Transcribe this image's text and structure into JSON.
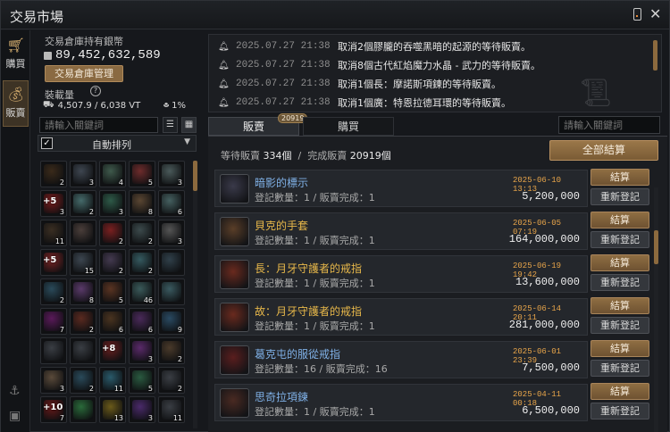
{
  "window": {
    "title": "交易市場"
  },
  "nav": {
    "buy": "購買",
    "sell": "販賣"
  },
  "storage": {
    "silver_label": "交易倉庫持有銀幣",
    "silver_value": "89,452,632,589",
    "manage_button": "交易倉庫管理",
    "weight_label": "裝載量",
    "weight_value": "4,507.9 / 6,038 VT",
    "percent": "1%"
  },
  "filter": {
    "search_placeholder": "請輸入關鍵詞",
    "auto_sort_label": "自動排列",
    "auto_sort_checked": "✓"
  },
  "inventory": [
    {
      "color": "#3a2a1a",
      "count": "2"
    },
    {
      "color": "#3e4650",
      "count": "3"
    },
    {
      "color": "#3f5a4c",
      "count": "4"
    },
    {
      "color": "#6e2c2c",
      "count": "5"
    },
    {
      "color": "#4a5a5a",
      "count": "3"
    },
    {
      "color": "#7a1c1c",
      "count": "3",
      "enh": "+5"
    },
    {
      "color": "#456a6a",
      "count": "2"
    },
    {
      "color": "#2e5a48",
      "count": "3"
    },
    {
      "color": "#5a4632",
      "count": "8"
    },
    {
      "color": "#456060",
      "count": "6"
    },
    {
      "color": "#3a2e22",
      "count": "11"
    },
    {
      "color": "#4a3e3a",
      "count": ""
    },
    {
      "color": "#7a2020",
      "count": "2"
    },
    {
      "color": "#3c4a4c",
      "count": "2"
    },
    {
      "color": "#555555",
      "count": "3"
    },
    {
      "color": "#7a2424",
      "count": "",
      "enh": "+5"
    },
    {
      "color": "#3c4650",
      "count": "15"
    },
    {
      "color": "#443a50",
      "count": "2"
    },
    {
      "color": "#355a60",
      "count": "2"
    },
    {
      "color": "#30404a",
      "count": ""
    },
    {
      "color": "#2a4a5a",
      "count": "2"
    },
    {
      "color": "#5a3a6a",
      "count": "8"
    },
    {
      "color": "#5a3422",
      "count": "5"
    },
    {
      "color": "#3a5a5a",
      "count": "46"
    },
    {
      "color": "#3a5a60",
      "count": ""
    },
    {
      "color": "#5a1a5a",
      "count": "7"
    },
    {
      "color": "#5a2a20",
      "count": "2"
    },
    {
      "color": "#4a3420",
      "count": "6"
    },
    {
      "color": "#4a2a5a",
      "count": "6"
    },
    {
      "color": "#2a4a62",
      "count": "9"
    },
    {
      "color": "#3a3e44",
      "count": ""
    },
    {
      "color": "#3a3e44",
      "count": ""
    },
    {
      "color": "#6a2020",
      "count": "",
      "enh": "+8"
    },
    {
      "color": "#5a2a6a",
      "count": "3"
    },
    {
      "color": "#4a3a2a",
      "count": "2"
    },
    {
      "color": "#5a4a3a",
      "count": "3"
    },
    {
      "color": "#2a4a5a",
      "count": "2"
    },
    {
      "color": "#2a5a6a",
      "count": "11"
    },
    {
      "color": "#2a5a40",
      "count": "5"
    },
    {
      "color": "#3a3e44",
      "count": "2"
    },
    {
      "color": "#6a1a1a",
      "count": "7",
      "enh": "+10"
    },
    {
      "color": "#2a6a3a",
      "count": ""
    },
    {
      "color": "#6a5a1a",
      "count": "13"
    },
    {
      "color": "#4a2a6a",
      "count": "3"
    },
    {
      "color": "#3a3e44",
      "count": "11"
    }
  ],
  "notices": [
    {
      "date": "2025.07.27 21:38",
      "text": "取消2個膠朧的吞噬黑暗的起源的等待販賣。"
    },
    {
      "date": "2025.07.27 21:38",
      "text": "取消8個古代紅焰魔力水晶 - 武力的等待販賣。"
    },
    {
      "date": "2025.07.27 21:38",
      "text": "取消1個長：摩諾斯項鍊的等待販賣。"
    },
    {
      "date": "2025.07.27 21:38",
      "text": "取消1個廣：特恩拉德耳環的等待販賣。"
    }
  ],
  "tabs": {
    "sell": "販賣",
    "sell_badge": "20919",
    "buy": "購買",
    "search_placeholder": "請輸入關鍵詞"
  },
  "summary": {
    "pending_label": "等待販賣",
    "pending_value": "334個",
    "sep": "/",
    "done_label": "完成販賣",
    "done_value": "20919個",
    "settle_all": "全部結算"
  },
  "buttons": {
    "settle": "結算",
    "relist": "重新登記"
  },
  "items": [
    {
      "name": "暗影的標示",
      "name_color": "#7fb0e6",
      "sub": "登記數量：1 / 販賣完成：1",
      "date": "2025-06-10 13:13",
      "price": "5,200,000",
      "icon_color": "#3a3a4a"
    },
    {
      "name": "貝克的手套",
      "name_color": "#e8b84a",
      "sub": "登記數量：1 / 販賣完成：1",
      "date": "2025-06-05 07:19",
      "price": "164,000,000",
      "icon_color": "#5a3e28"
    },
    {
      "name": "長：月牙守護者的戒指",
      "name_color": "#e8b84a",
      "sub": "登記數量：1 / 販賣完成：1",
      "date": "2025-06-19 19:42",
      "price": "13,600,000",
      "icon_color": "#6a2a1e"
    },
    {
      "name": "故：月牙守護者的戒指",
      "name_color": "#e8b84a",
      "sub": "登記數量：1 / 販賣完成：1",
      "date": "2025-06-14 20:11",
      "price": "281,000,000",
      "icon_color": "#6a2a1e"
    },
    {
      "name": "葛克屯的服從戒指",
      "name_color": "#7fb0e6",
      "sub": "登記數量：16 / 販賣完成：16",
      "date": "2025-06-01 23:39",
      "price": "7,500,000",
      "icon_color": "#5a1e1e"
    },
    {
      "name": "思奇拉項鍊",
      "name_color": "#7fb0e6",
      "sub": "登記數量：1 / 販賣完成：1",
      "date": "2025-04-11 00:18",
      "price": "6,500,000",
      "icon_color": "#4a2a22"
    }
  ]
}
